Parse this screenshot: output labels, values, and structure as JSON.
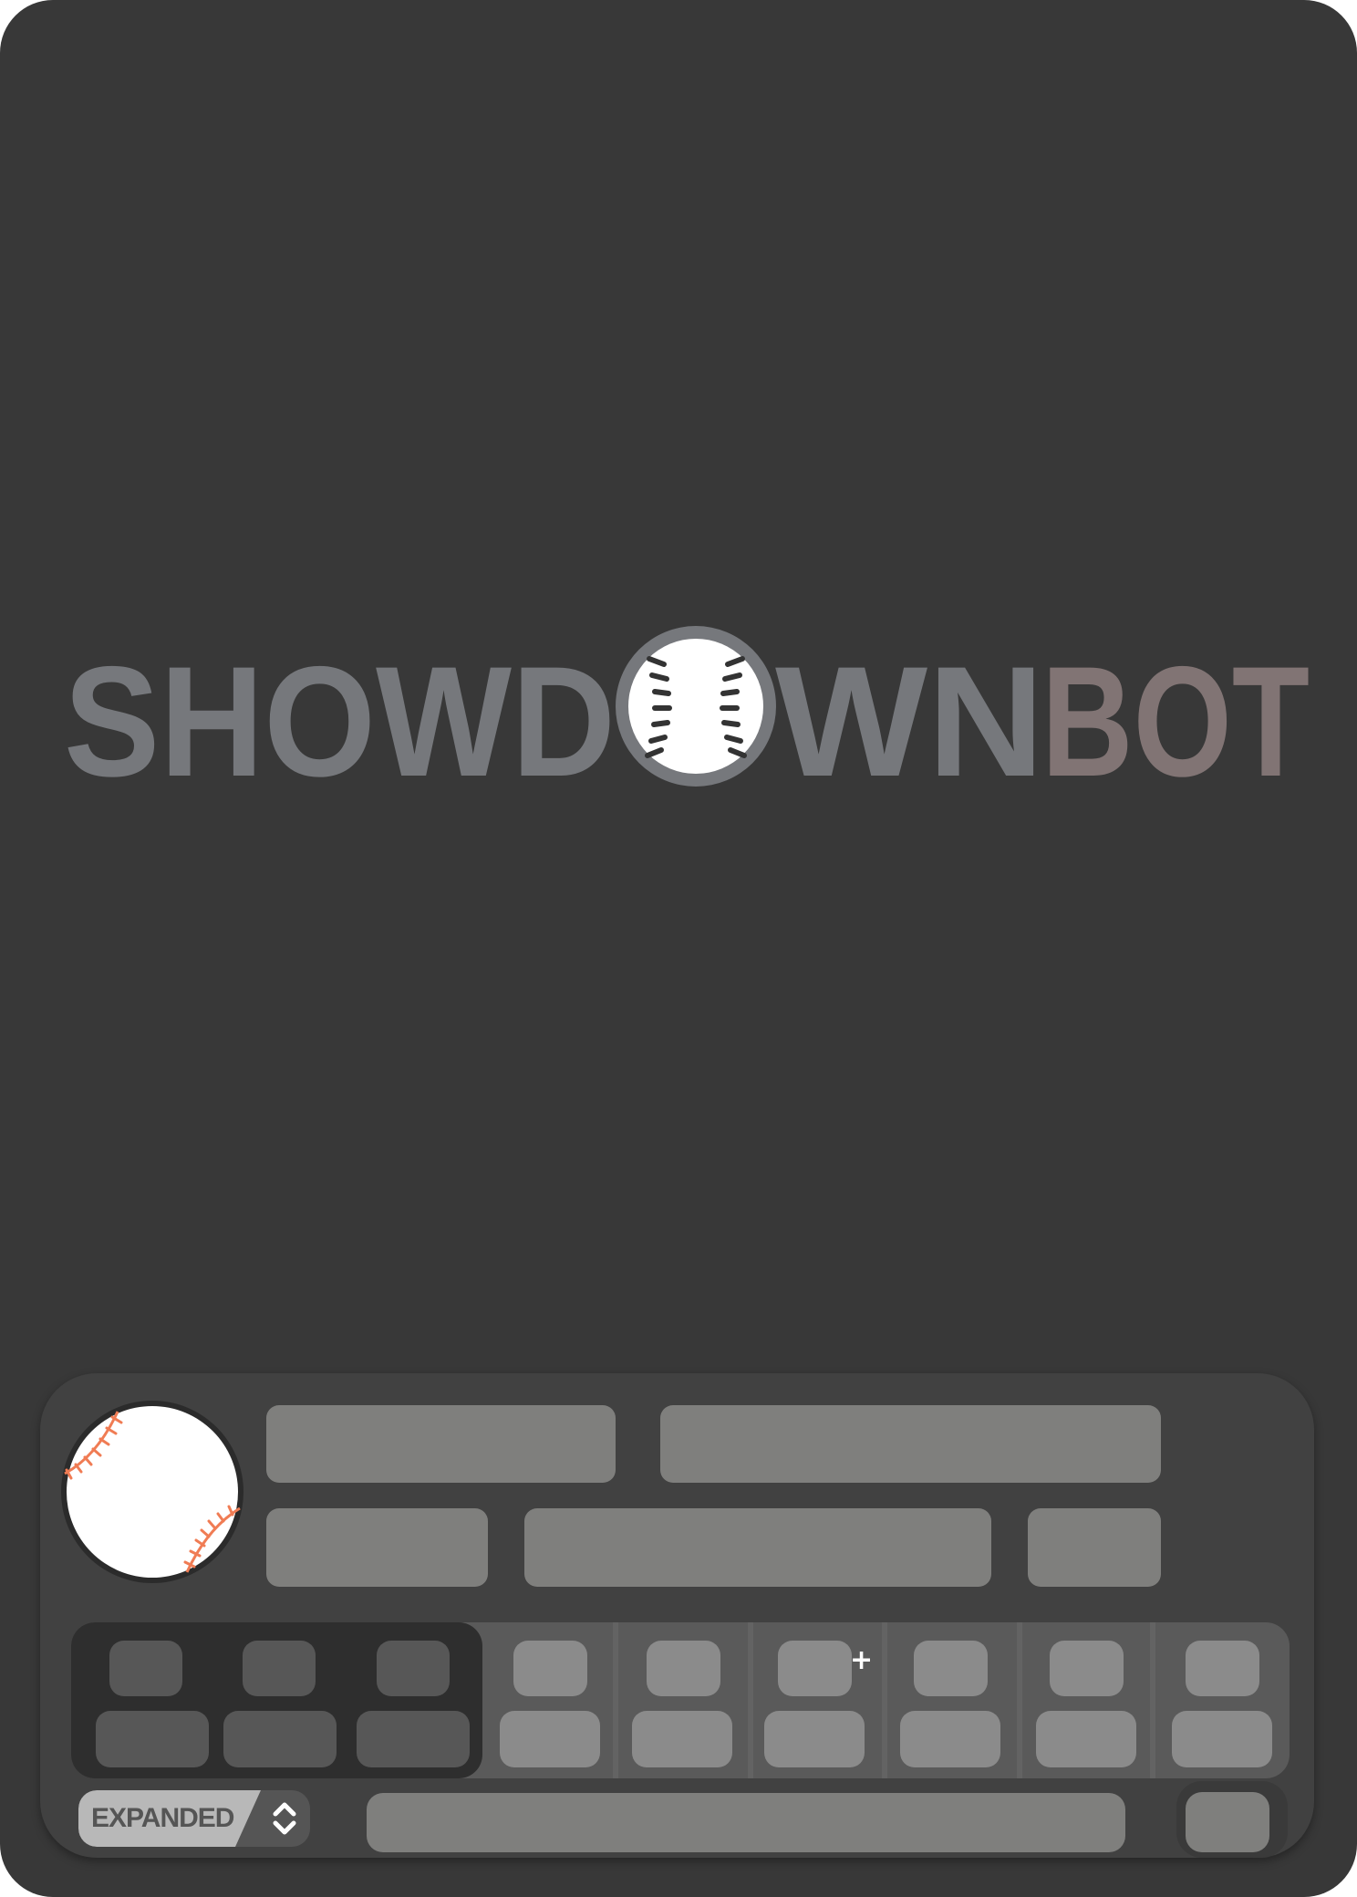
{
  "logo": {
    "part_gray": "SHOWD",
    "part_after_ball": "WN",
    "part_accent": "BOT",
    "gray_color": "#76787c",
    "accent_color": "#817474",
    "ball_icon": "baseball-icon"
  },
  "card": {
    "background": "#383838",
    "panel_background": "#414141"
  },
  "player_avatar": {
    "icon": "baseball-icon",
    "stitch_color": "#f07c54"
  },
  "stats": {
    "plus_symbol": "+"
  },
  "footer": {
    "expanded_label": "EXPANDED",
    "toggle_icon": "chevron-up-down-icon"
  }
}
